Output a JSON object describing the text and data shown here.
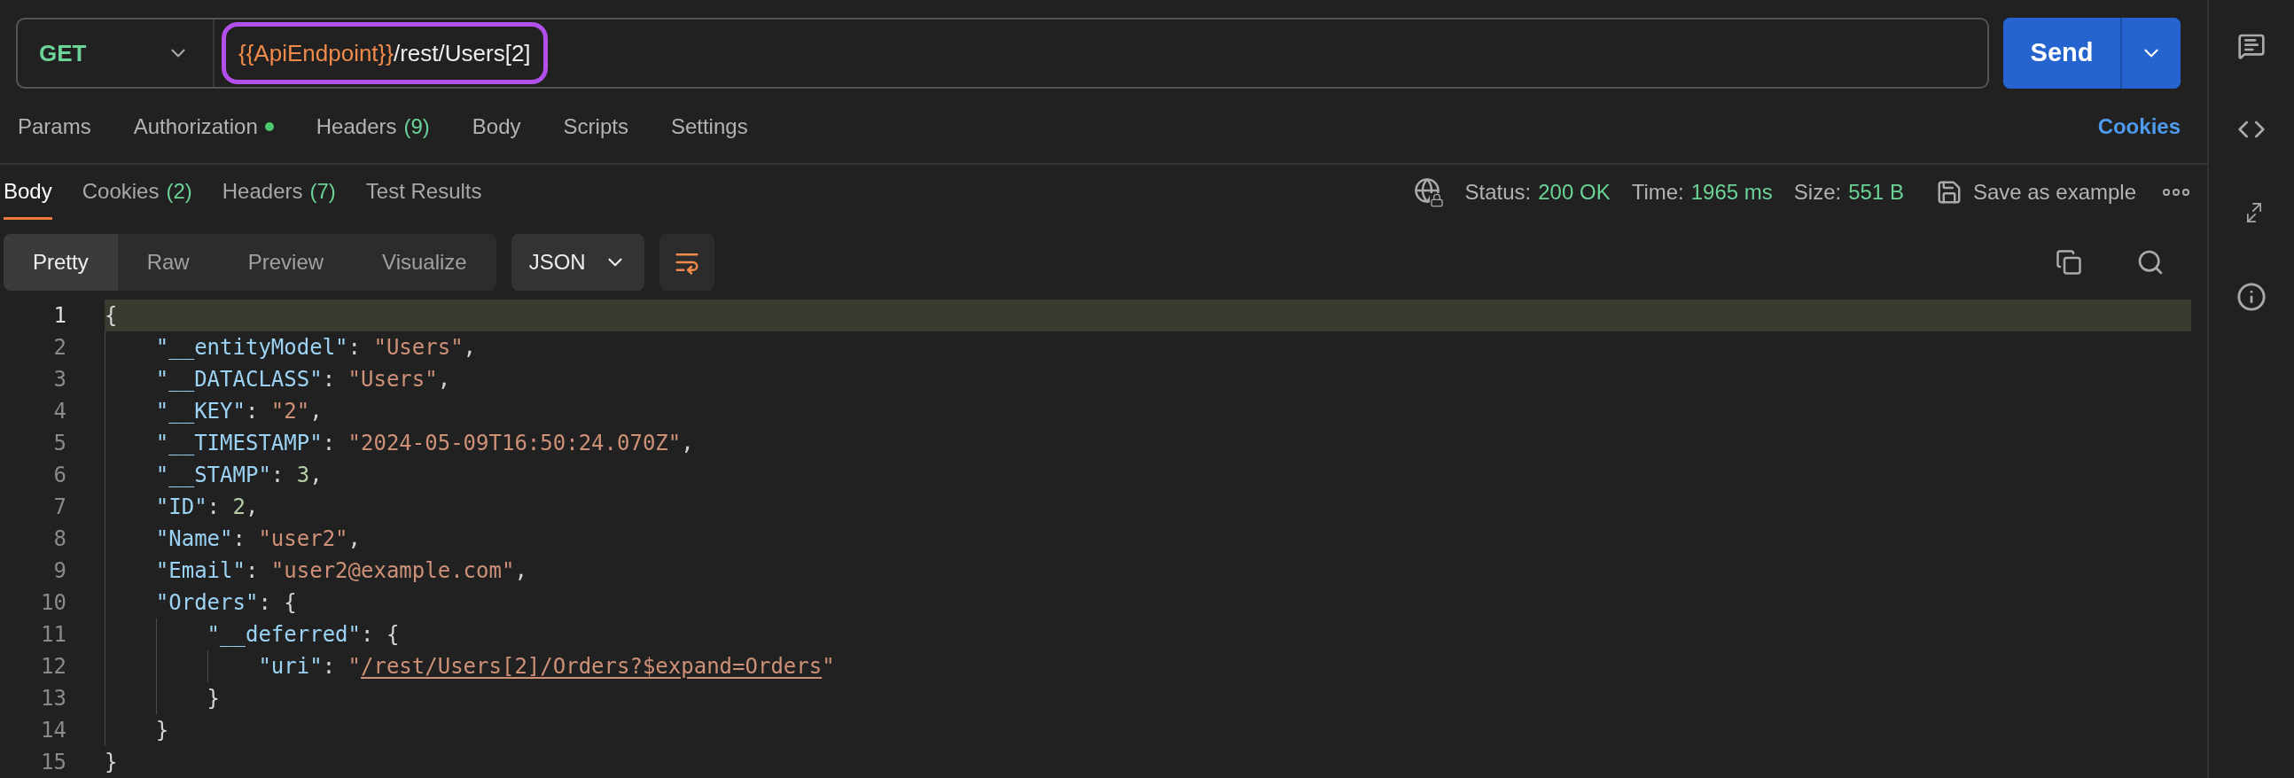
{
  "request": {
    "method": "GET",
    "url_variable": "{{ApiEndpoint}}",
    "url_path": "/rest/Users[2]",
    "send": "Send"
  },
  "request_tabs": [
    {
      "label": "Params",
      "dot": false
    },
    {
      "label": "Authorization",
      "dot": true
    },
    {
      "label": "Headers",
      "count": "(9)",
      "dot": false
    },
    {
      "label": "Body",
      "dot": false
    },
    {
      "label": "Scripts",
      "dot": false
    },
    {
      "label": "Settings",
      "dot": false
    }
  ],
  "cookies_link": "Cookies",
  "response_tabs": [
    {
      "label": "Body",
      "selected": true
    },
    {
      "label": "Cookies",
      "count": "(2)",
      "selected": false
    },
    {
      "label": "Headers",
      "count": "(7)",
      "selected": false
    },
    {
      "label": "Test Results",
      "selected": false
    }
  ],
  "response_meta": [
    {
      "label": "Status:",
      "value": "200 OK"
    },
    {
      "label": "Time:",
      "value": "1965 ms"
    },
    {
      "label": "Size:",
      "value": "551 B"
    }
  ],
  "save_example": "Save as example",
  "view_modes": [
    {
      "label": "Pretty",
      "selected": true
    },
    {
      "label": "Raw",
      "selected": false
    },
    {
      "label": "Preview",
      "selected": false
    },
    {
      "label": "Visualize",
      "selected": false
    }
  ],
  "format": "JSON",
  "code_lines": [
    {
      "number": "1",
      "current": true,
      "tokens": [
        {
          "kind": "punct",
          "text": "{"
        }
      ]
    },
    {
      "number": "2",
      "current": false,
      "tokens": [
        {
          "kind": "key",
          "text": "    \"__entityModel\""
        },
        {
          "kind": "punct",
          "text": ": "
        },
        {
          "kind": "string",
          "text": "\"Users\""
        },
        {
          "kind": "punct",
          "text": ","
        }
      ]
    },
    {
      "number": "3",
      "current": false,
      "tokens": [
        {
          "kind": "key",
          "text": "    \"__DATACLASS\""
        },
        {
          "kind": "punct",
          "text": ": "
        },
        {
          "kind": "string",
          "text": "\"Users\""
        },
        {
          "kind": "punct",
          "text": ","
        }
      ]
    },
    {
      "number": "4",
      "current": false,
      "tokens": [
        {
          "kind": "key",
          "text": "    \"__KEY\""
        },
        {
          "kind": "punct",
          "text": ": "
        },
        {
          "kind": "string",
          "text": "\"2\""
        },
        {
          "kind": "punct",
          "text": ","
        }
      ]
    },
    {
      "number": "5",
      "current": false,
      "tokens": [
        {
          "kind": "key",
          "text": "    \"__TIMESTAMP\""
        },
        {
          "kind": "punct",
          "text": ": "
        },
        {
          "kind": "string",
          "text": "\"2024-05-09T16:50:24.070Z\""
        },
        {
          "kind": "punct",
          "text": ","
        }
      ]
    },
    {
      "number": "6",
      "current": false,
      "tokens": [
        {
          "kind": "key",
          "text": "    \"__STAMP\""
        },
        {
          "kind": "punct",
          "text": ": "
        },
        {
          "kind": "number",
          "text": "3"
        },
        {
          "kind": "punct",
          "text": ","
        }
      ]
    },
    {
      "number": "7",
      "current": false,
      "tokens": [
        {
          "kind": "key",
          "text": "    \"ID\""
        },
        {
          "kind": "punct",
          "text": ": "
        },
        {
          "kind": "number",
          "text": "2"
        },
        {
          "kind": "punct",
          "text": ","
        }
      ]
    },
    {
      "number": "8",
      "current": false,
      "tokens": [
        {
          "kind": "key",
          "text": "    \"Name\""
        },
        {
          "kind": "punct",
          "text": ": "
        },
        {
          "kind": "string",
          "text": "\"user2\""
        },
        {
          "kind": "punct",
          "text": ","
        }
      ]
    },
    {
      "number": "9",
      "current": false,
      "tokens": [
        {
          "kind": "key",
          "text": "    \"Email\""
        },
        {
          "kind": "punct",
          "text": ": "
        },
        {
          "kind": "string",
          "text": "\"user2@example.com\""
        },
        {
          "kind": "punct",
          "text": ","
        }
      ]
    },
    {
      "number": "10",
      "current": false,
      "tokens": [
        {
          "kind": "key",
          "text": "    \"Orders\""
        },
        {
          "kind": "punct",
          "text": ": {"
        }
      ]
    },
    {
      "number": "11",
      "current": false,
      "tokens": [
        {
          "kind": "key",
          "text": "        \"__deferred\""
        },
        {
          "kind": "punct",
          "text": ": {"
        }
      ]
    },
    {
      "number": "12",
      "current": false,
      "tokens": [
        {
          "kind": "key",
          "text": "            \"uri\""
        },
        {
          "kind": "punct",
          "text": ": "
        },
        {
          "kind": "string",
          "text": "\""
        },
        {
          "kind": "link",
          "text": "/rest/Users[2]/Orders?$expand=Orders"
        },
        {
          "kind": "string",
          "text": "\""
        }
      ]
    },
    {
      "number": "13",
      "current": false,
      "tokens": [
        {
          "kind": "punct",
          "text": "        }"
        }
      ]
    },
    {
      "number": "14",
      "current": false,
      "tokens": [
        {
          "kind": "punct",
          "text": "    }"
        }
      ]
    },
    {
      "number": "15",
      "current": false,
      "tokens": [
        {
          "kind": "punct",
          "text": "}"
        }
      ]
    }
  ]
}
